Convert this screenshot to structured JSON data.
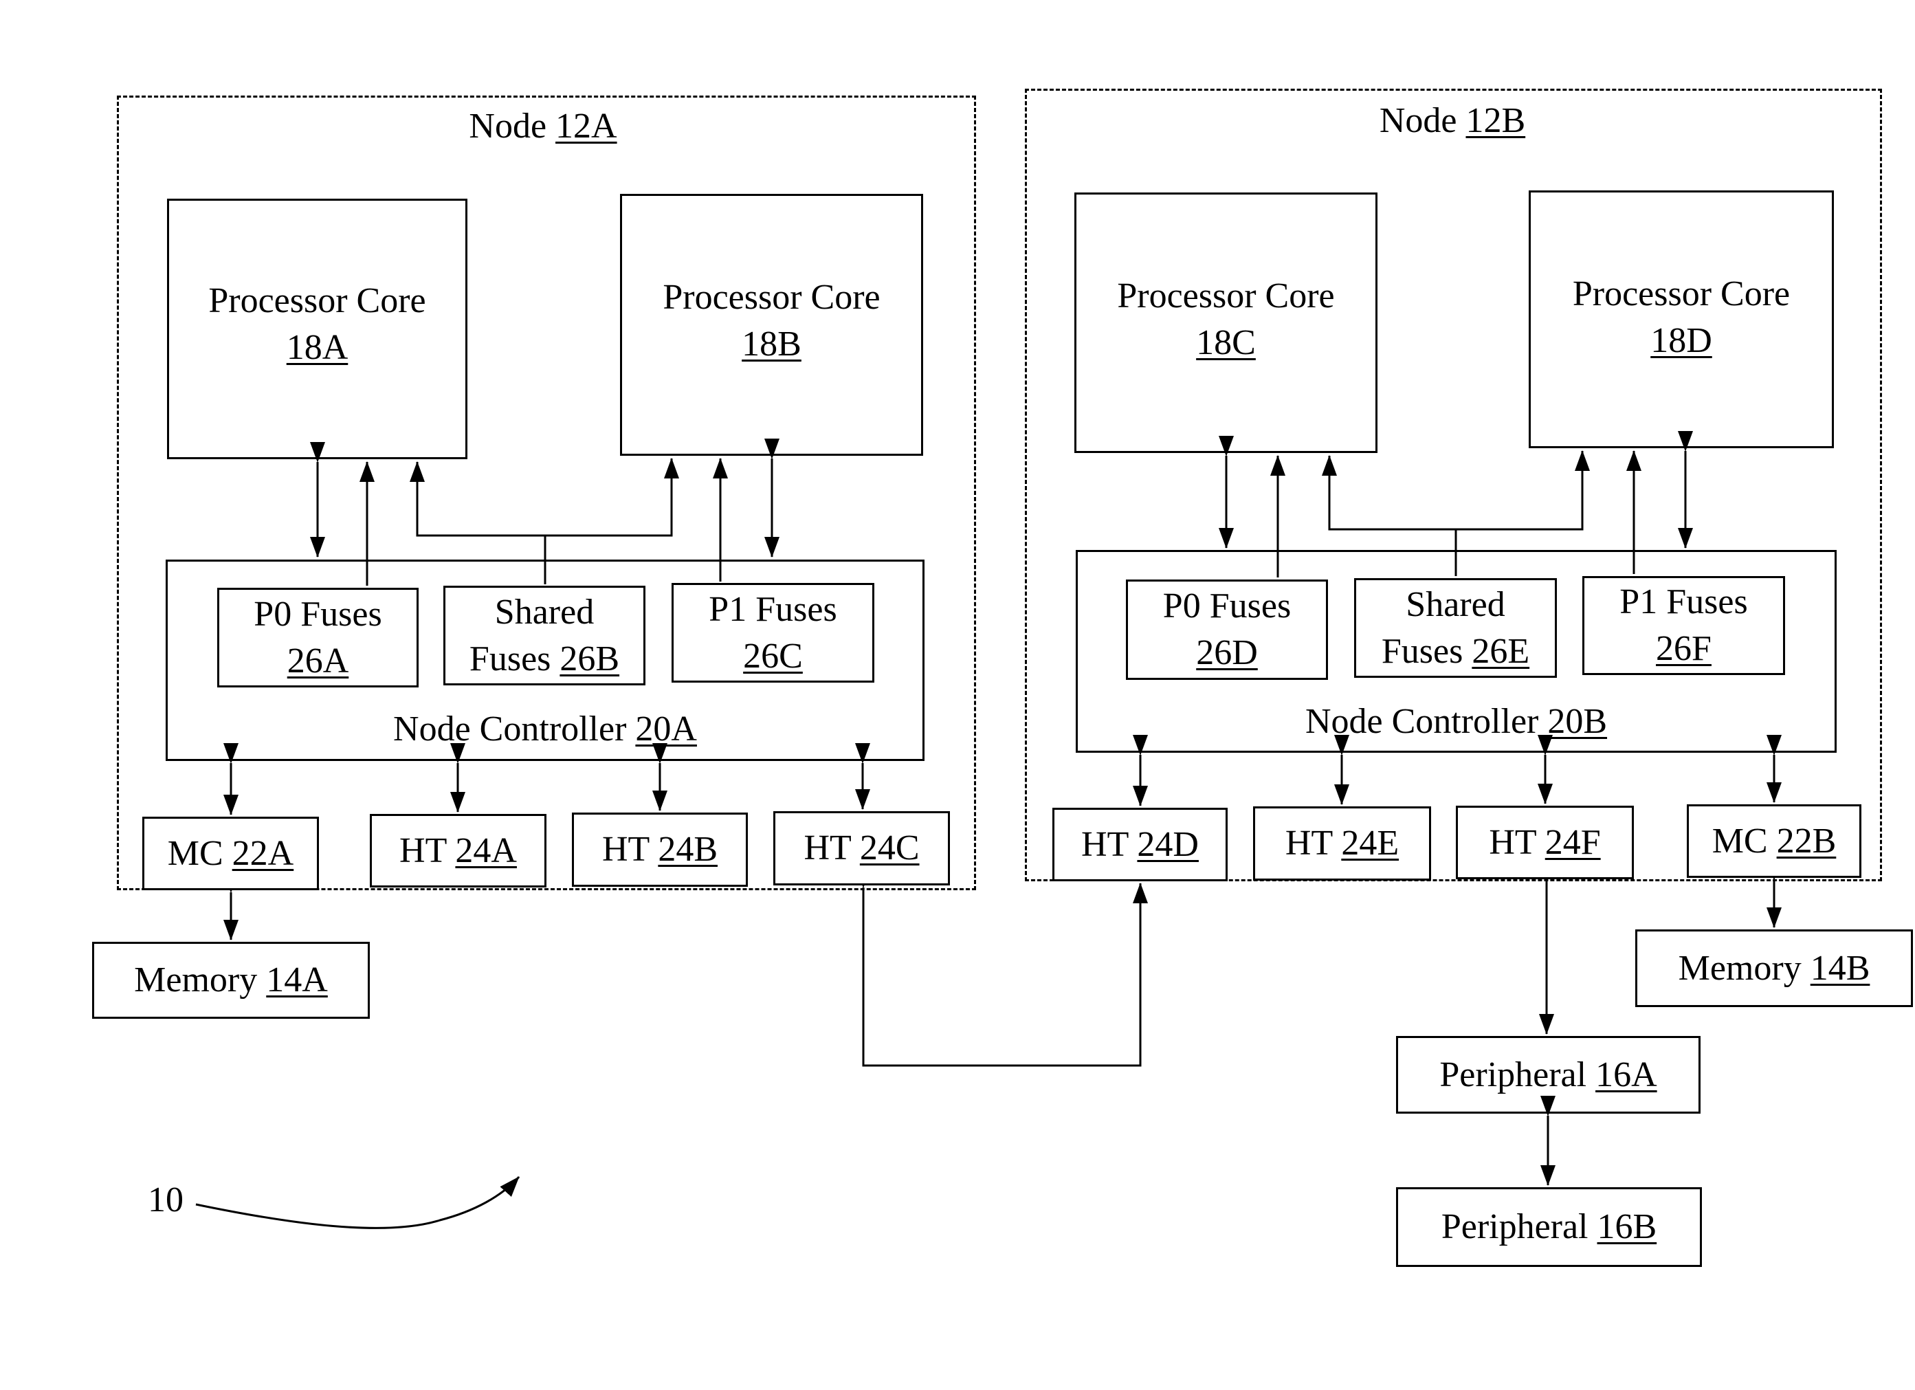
{
  "figure": {
    "reference_numeral": "10",
    "nodes": [
      {
        "name": "Node",
        "ref": "12A",
        "cores": [
          {
            "name": "Processor Core",
            "ref": "18A"
          },
          {
            "name": "Processor Core",
            "ref": "18B"
          }
        ],
        "node_controller": {
          "name": "Node Controller",
          "ref": "20A"
        },
        "fuses": [
          {
            "line1": "P0 Fuses",
            "ref": "26A",
            "prefix2": ""
          },
          {
            "line1": "Shared",
            "ref": "26B",
            "prefix2": "Fuses "
          },
          {
            "line1": "P1 Fuses",
            "ref": "26C",
            "prefix2": ""
          }
        ],
        "interfaces": [
          {
            "name": "MC",
            "ref": "22A"
          },
          {
            "name": "HT",
            "ref": "24A"
          },
          {
            "name": "HT",
            "ref": "24B"
          },
          {
            "name": "HT",
            "ref": "24C"
          }
        ]
      },
      {
        "name": "Node",
        "ref": "12B",
        "cores": [
          {
            "name": "Processor Core",
            "ref": "18C"
          },
          {
            "name": "Processor Core",
            "ref": "18D"
          }
        ],
        "node_controller": {
          "name": "Node Controller",
          "ref": "20B"
        },
        "fuses": [
          {
            "line1": "P0 Fuses",
            "ref": "26D",
            "prefix2": ""
          },
          {
            "line1": "Shared",
            "ref": "26E",
            "prefix2": "Fuses "
          },
          {
            "line1": "P1 Fuses",
            "ref": "26F",
            "prefix2": ""
          }
        ],
        "interfaces": [
          {
            "name": "HT",
            "ref": "24D"
          },
          {
            "name": "HT",
            "ref": "24E"
          },
          {
            "name": "HT",
            "ref": "24F"
          },
          {
            "name": "MC",
            "ref": "22B"
          }
        ]
      }
    ],
    "memories": [
      {
        "name": "Memory",
        "ref": "14A"
      },
      {
        "name": "Memory",
        "ref": "14B"
      }
    ],
    "peripherals": [
      {
        "name": "Peripheral",
        "ref": "16A"
      },
      {
        "name": "Peripheral",
        "ref": "16B"
      }
    ],
    "connections": [
      {
        "from": "18A",
        "to": "20A",
        "type": "bidirectional"
      },
      {
        "from": "26A",
        "to": "18A",
        "type": "unidirectional"
      },
      {
        "from": "26B",
        "to": [
          "18A",
          "18B"
        ],
        "type": "unidirectional"
      },
      {
        "from": "26C",
        "to": "18B",
        "type": "unidirectional"
      },
      {
        "from": "18B",
        "to": "20A",
        "type": "bidirectional"
      },
      {
        "from": "18C",
        "to": "20B",
        "type": "bidirectional"
      },
      {
        "from": "26D",
        "to": "18C",
        "type": "unidirectional"
      },
      {
        "from": "26E",
        "to": [
          "18C",
          "18D"
        ],
        "type": "unidirectional"
      },
      {
        "from": "26F",
        "to": "18D",
        "type": "unidirectional"
      },
      {
        "from": "18D",
        "to": "20B",
        "type": "bidirectional"
      },
      {
        "from": "20A",
        "to": "22A",
        "type": "bidirectional"
      },
      {
        "from": "20A",
        "to": "24A",
        "type": "bidirectional"
      },
      {
        "from": "20A",
        "to": "24B",
        "type": "bidirectional"
      },
      {
        "from": "20A",
        "to": "24C",
        "type": "bidirectional"
      },
      {
        "from": "20B",
        "to": "24D",
        "type": "bidirectional"
      },
      {
        "from": "20B",
        "to": "24E",
        "type": "bidirectional"
      },
      {
        "from": "20B",
        "to": "24F",
        "type": "bidirectional"
      },
      {
        "from": "20B",
        "to": "22B",
        "type": "bidirectional"
      },
      {
        "from": "22A",
        "to": "14A",
        "type": "bidirectional"
      },
      {
        "from": "22B",
        "to": "14B",
        "type": "bidirectional"
      },
      {
        "from": "24C",
        "to": "24D",
        "type": "bidirectional"
      },
      {
        "from": "24F",
        "to": "16A",
        "type": "bidirectional"
      },
      {
        "from": "16A",
        "to": "16B",
        "type": "bidirectional"
      }
    ]
  }
}
